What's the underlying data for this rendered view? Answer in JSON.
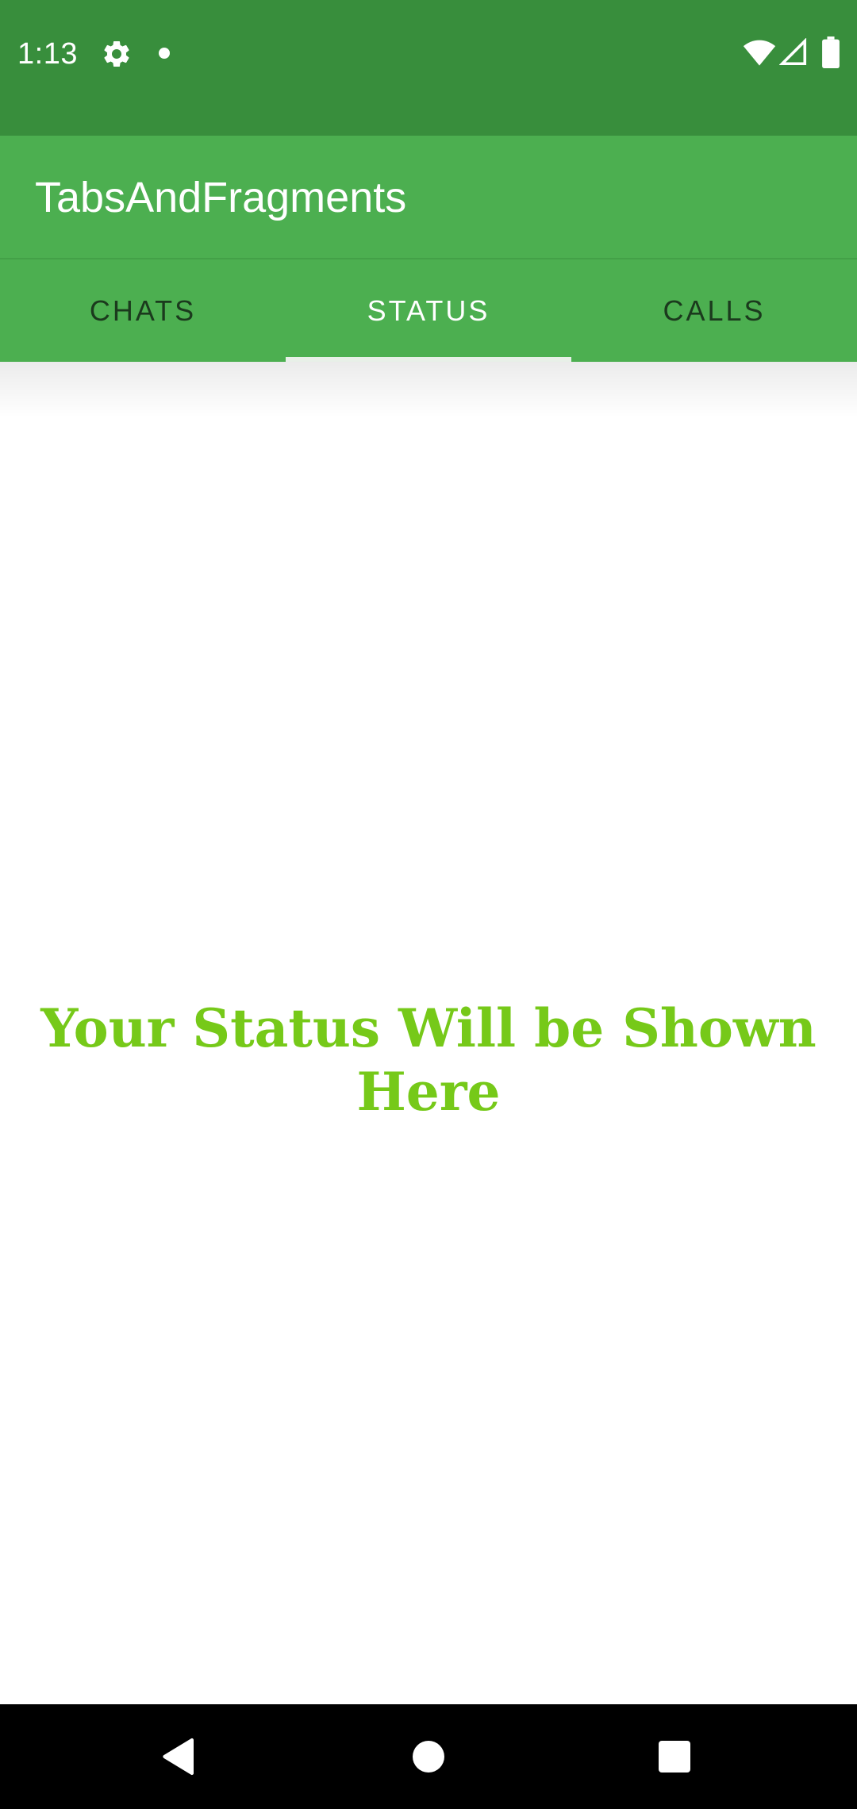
{
  "status_bar": {
    "time": "1:13",
    "icons": [
      "gear-icon",
      "notification-dot-icon",
      "wifi-icon",
      "signal-icon",
      "battery-icon"
    ]
  },
  "app_bar": {
    "title": "TabsAndFragments"
  },
  "tabs": [
    {
      "label": "CHATS",
      "active": false
    },
    {
      "label": "STATUS",
      "active": true
    },
    {
      "label": "CALLS",
      "active": false
    }
  ],
  "content": {
    "message": "Your Status Will be Shown Here"
  },
  "nav_bar": {
    "icons": [
      "back-icon",
      "home-icon",
      "recents-icon"
    ]
  },
  "colors": {
    "status_bar": "#388e3c",
    "primary": "#4caf50",
    "message": "#76c919",
    "tab_inactive_text": "#1b3a1d",
    "tab_active_text": "#ffffff"
  }
}
